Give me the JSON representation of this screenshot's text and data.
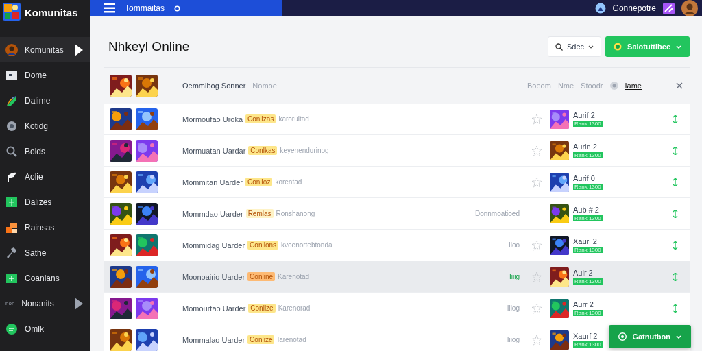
{
  "sidebar": {
    "brand": "Komunitas",
    "items": [
      {
        "label": "Komunitas",
        "selected": true
      },
      {
        "label": "Dome",
        "selected": false
      },
      {
        "label": "Dalime",
        "selected": false
      },
      {
        "label": "Kotidg",
        "selected": false
      },
      {
        "label": "Bolds",
        "selected": false
      },
      {
        "label": "Aolie",
        "selected": false
      },
      {
        "label": "Dalizes",
        "selected": false
      },
      {
        "label": "Rainsas",
        "selected": false
      },
      {
        "label": "Sathe",
        "selected": false
      },
      {
        "label": "Coanians",
        "selected": false
      },
      {
        "label": "Nonanits",
        "prefix": "non",
        "selected": false
      },
      {
        "label": "Omlk",
        "selected": false
      }
    ]
  },
  "topbar": {
    "title": "Tommaitas",
    "user": "Gonnepotre"
  },
  "page": {
    "title": "Nhkeyl Online",
    "select": {
      "label": "Sdec"
    },
    "action": {
      "label": "Salotuttibee"
    }
  },
  "table": {
    "header": {
      "title": "Oemmibog Sonner",
      "subtitle": "Nomoe",
      "columns": [
        {
          "label": "Boeom",
          "selected": false
        },
        {
          "label": "Nme",
          "selected": false
        },
        {
          "label": "Stoodr",
          "selected": false
        },
        {
          "label": "Iame",
          "selected": true
        }
      ]
    },
    "rows": [
      {
        "name": "Mormoufao Uroka",
        "badge": {
          "text": "Conlizas",
          "color": "#fde68a"
        },
        "desc": "karoruitad",
        "star": true,
        "game": "Aurif 2",
        "tag": "Rank 1300",
        "selected": false
      },
      {
        "name": "Mormuatan Uardar",
        "badge": {
          "text": "Conlkas",
          "color": "#fde68a"
        },
        "desc": "keyenendurinog",
        "star": true,
        "game": "Aurin 2",
        "tag": "Rank 1300",
        "selected": false
      },
      {
        "name": "Mommitan Uarder",
        "badge": {
          "text": "Conlioz",
          "color": "#fde68a"
        },
        "desc": "korentad",
        "star": true,
        "game": "Aurif 0",
        "tag": "Rank 1300",
        "selected": false
      },
      {
        "name": "Mommdao Uarder",
        "badge": {
          "text": "Remlas",
          "color": "#fef3c7"
        },
        "desc": "Ronshanong",
        "extra": {
          "text": "Donnmoatioed",
          "kind": "muted"
        },
        "star": false,
        "game": "Aub # 2",
        "tag": "Rank 1300",
        "selected": false
      },
      {
        "name": "Mommidag Uarder",
        "badge": {
          "text": "Conlions",
          "color": "#fde68a"
        },
        "desc": "kvoenortebtonda",
        "extra": {
          "text": "Iioo",
          "kind": "muted"
        },
        "star": true,
        "game": "Xauri 2",
        "tag": "Rank 1300",
        "selected": false
      },
      {
        "name": "Moonoairio Uarder",
        "badge": {
          "text": "Conline",
          "color": "#fdba74"
        },
        "desc": "Karenotad",
        "extra": {
          "text": "Iiiig",
          "kind": "positive"
        },
        "star": true,
        "game": "Aulr 2",
        "tag": "Rank 1300",
        "selected": true
      },
      {
        "name": "Momourtao Uarder",
        "badge": {
          "text": "Conlize",
          "color": "#fde68a"
        },
        "desc": "Karenorad",
        "extra": {
          "text": "Iiiog",
          "kind": "muted"
        },
        "star": true,
        "game": "Aurr 2",
        "tag": "Rank 1300",
        "selected": false
      },
      {
        "name": "Mommalao Uarder",
        "badge": {
          "text": "Conlize",
          "color": "#fde68a"
        },
        "desc": "Iarenotad",
        "extra": {
          "text": "Iiiog",
          "kind": "muted"
        },
        "star": true,
        "game": "Xaurf 2",
        "tag": "Rank 1300",
        "selected": false
      }
    ]
  },
  "floating_button": {
    "label": "Gatnutbon"
  }
}
